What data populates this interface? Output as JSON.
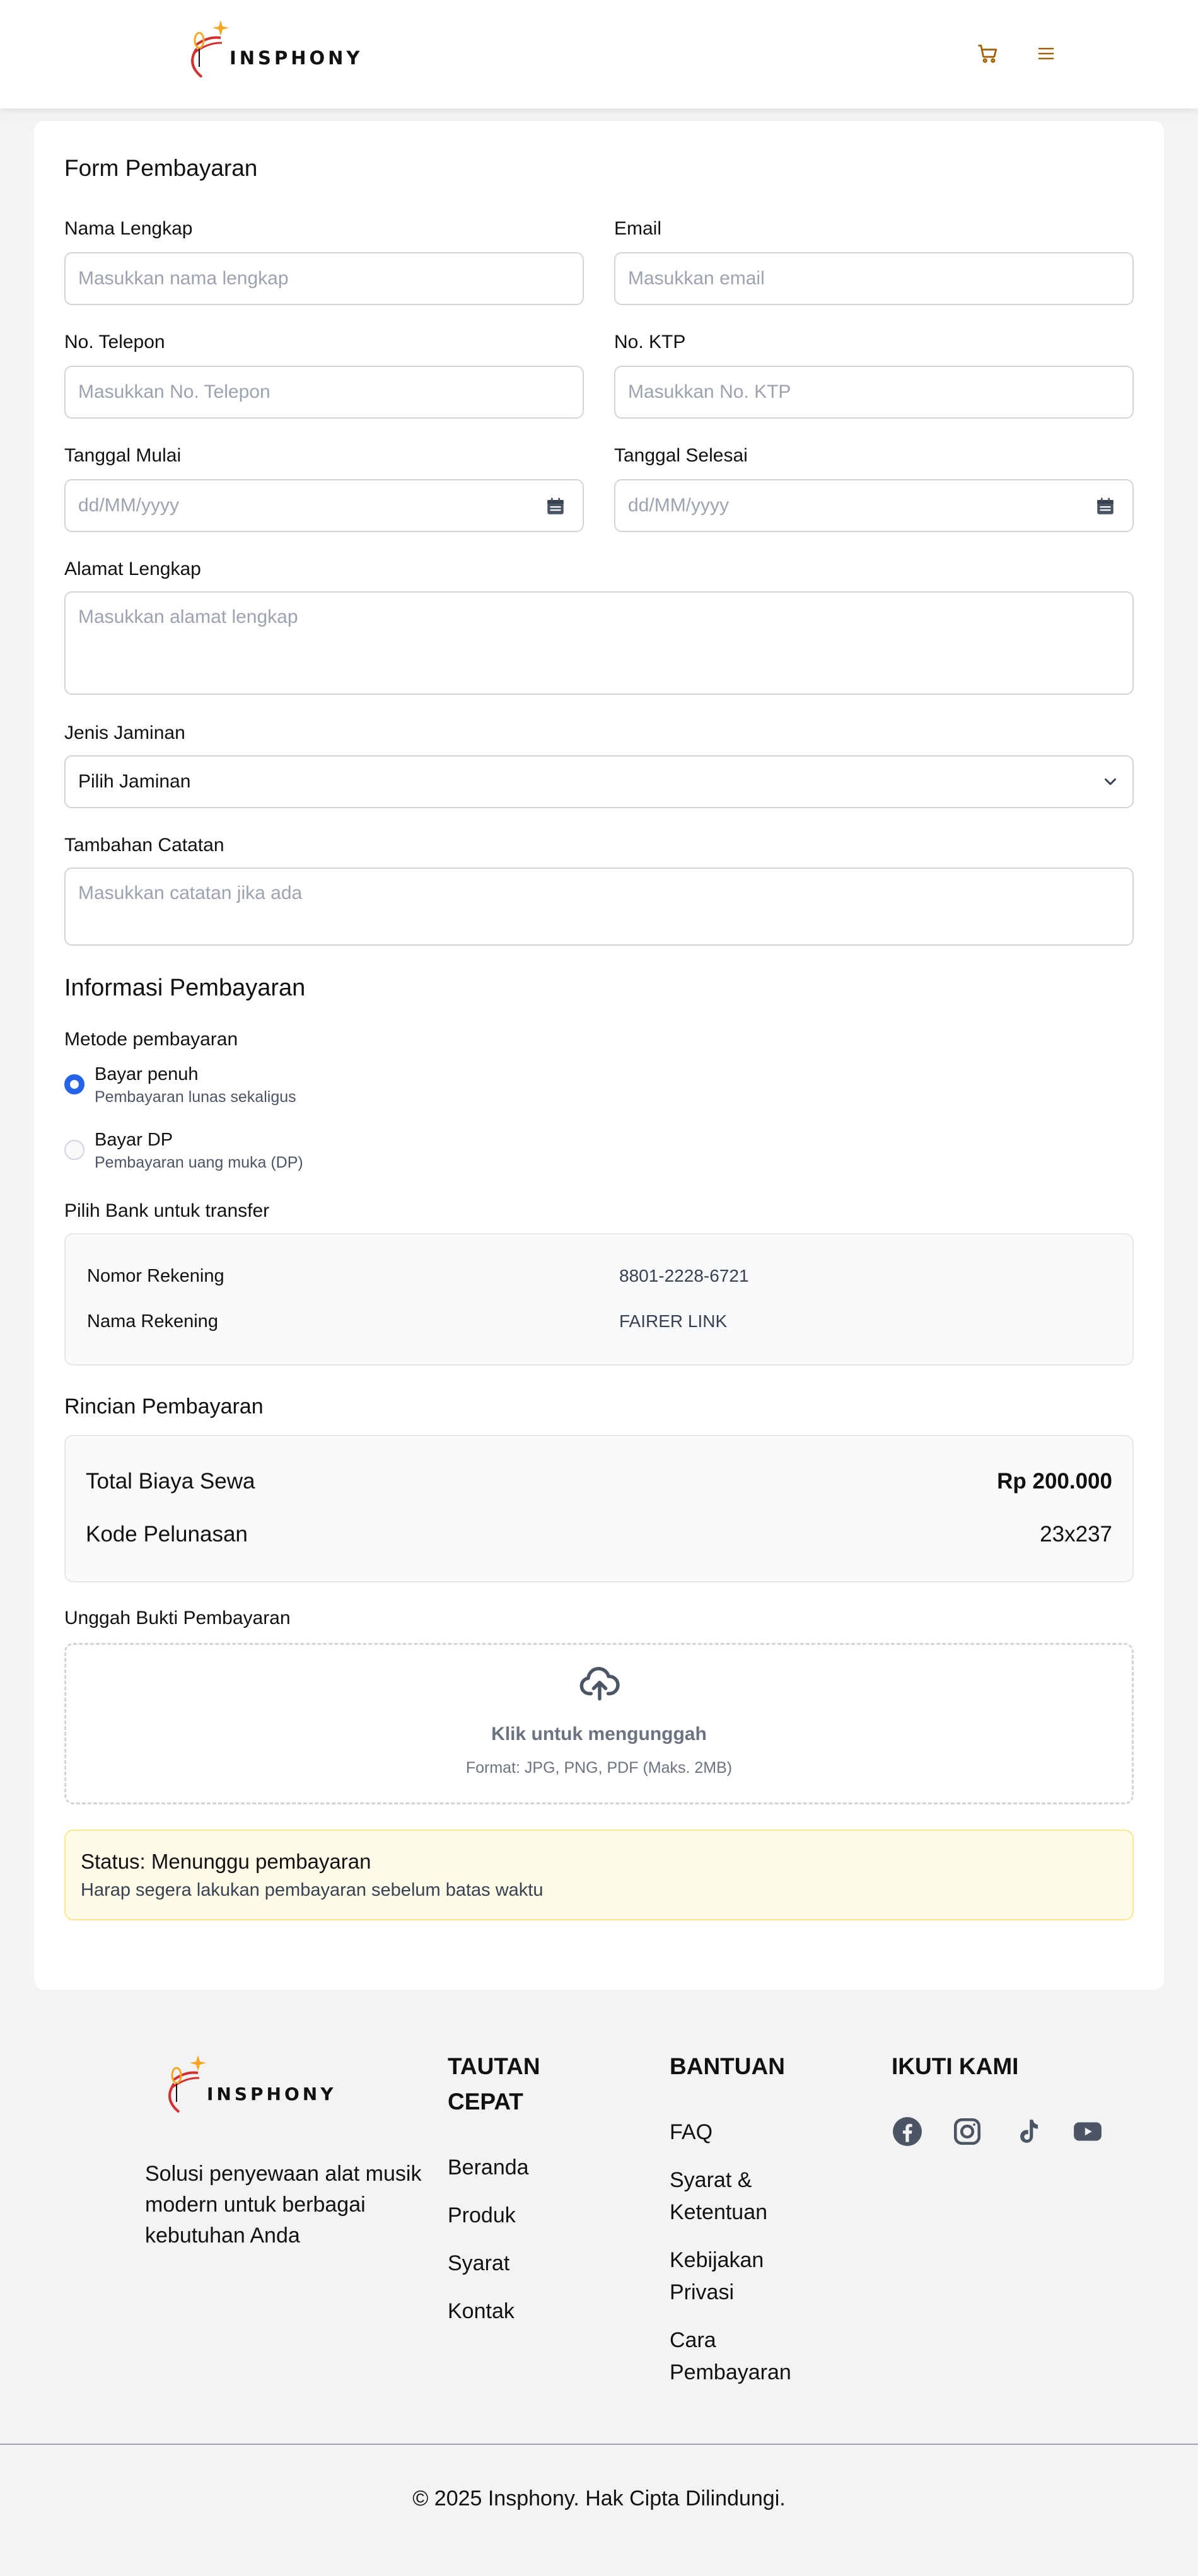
{
  "brand": {
    "name": "INSPHONY",
    "accent": "#f5a623",
    "logo_red": "#d32f2f"
  },
  "header": {
    "cart_icon": "cart-icon",
    "menu_icon": "hamburger-menu-icon"
  },
  "form": {
    "title": "Form Pembayaran",
    "nama": {
      "label": "Nama Lengkap",
      "placeholder": "Masukkan nama lengkap"
    },
    "email": {
      "label": "Email",
      "placeholder": "Masukkan email"
    },
    "telepon": {
      "label": "No. Telepon",
      "placeholder": "Masukkan No. Telepon"
    },
    "ktp": {
      "label": "No. KTP",
      "placeholder": "Masukkan No. KTP"
    },
    "tanggal_mulai": {
      "label": "Tanggal Mulai",
      "placeholder": "dd/MM/yyyy"
    },
    "tanggal_selesai": {
      "label": "Tanggal Selesai",
      "placeholder": "dd/MM/yyyy"
    },
    "alamat": {
      "label": "Alamat Lengkap",
      "placeholder": "Masukkan alamat lengkap"
    },
    "jaminan": {
      "label": "Jenis Jaminan",
      "selected": "Pilih Jaminan"
    },
    "catatan": {
      "label": "Tambahan Catatan",
      "placeholder": "Masukkan catatan jika ada"
    }
  },
  "payment": {
    "title": "Informasi Pembayaran",
    "method_label": "Metode pembayaran",
    "options": [
      {
        "title": "Bayar penuh",
        "desc": "Pembayaran lunas sekaligus",
        "selected": true
      },
      {
        "title": "Bayar DP",
        "desc": "Pembayaran uang muka (DP)",
        "selected": false
      }
    ],
    "bank_label": "Pilih Bank untuk transfer",
    "bank": {
      "account_number_label": "Nomor Rekening",
      "account_number": "8801-2228-6721",
      "account_name_label": "Nama Rekening",
      "account_name": "FAIRER LINK"
    }
  },
  "rincian": {
    "title": "Rincian Pembayaran",
    "total_label": "Total Biaya Sewa",
    "total_value": "Rp 200.000",
    "kode_label": "Kode Pelunasan",
    "kode_value": "23x237"
  },
  "upload": {
    "label": "Unggah Bukti Pembayaran",
    "title": "Klik untuk mengunggah",
    "format": "Format: JPG, PNG, PDF (Maks. 2MB)"
  },
  "status": {
    "title": "Status: Menunggu pembayaran",
    "desc": "Harap segera lakukan pembayaran sebelum batas waktu"
  },
  "footer": {
    "tagline": "Solusi penyewaan alat musik modern untuk berbagai kebutuhan Anda",
    "tautan": {
      "heading": "TAUTAN CEPAT",
      "links": [
        "Beranda",
        "Produk",
        "Syarat",
        "Kontak"
      ]
    },
    "bantuan": {
      "heading": "BANTUAN",
      "links": [
        "FAQ",
        "Syarat & Ketentuan",
        "Kebijakan Privasi",
        "Cara Pembayaran"
      ]
    },
    "ikuti": {
      "heading": "IKUTI KAMI",
      "icons": [
        "facebook-icon",
        "instagram-icon",
        "tiktok-icon",
        "youtube-icon"
      ]
    },
    "copyright": "© 2025 Insphony. Hak Cipta Dilindungi."
  }
}
